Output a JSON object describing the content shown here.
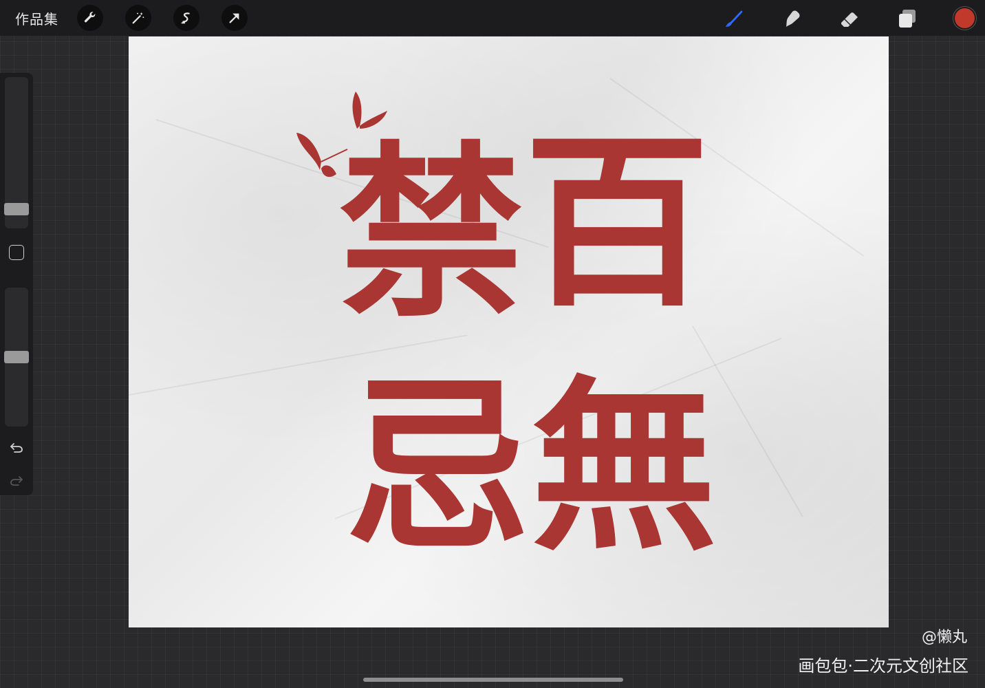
{
  "topbar": {
    "gallery_label": "作品集",
    "left_tools": [
      "wrench-icon",
      "magic-wand-icon",
      "selection-icon",
      "transform-arrow-icon"
    ],
    "right_tools": [
      "brush-icon",
      "smudge-icon",
      "eraser-icon",
      "layers-icon"
    ],
    "active_tool": "brush-icon",
    "active_color": "#c0392b",
    "brush_accent": "#2f6bff"
  },
  "sidebar": {
    "brush_size_level": 0.5,
    "opacity_level": 0.5
  },
  "canvas": {
    "characters": [
      "禁",
      "百",
      "忌",
      "無"
    ],
    "ink_color": "#a93632"
  },
  "watermark": {
    "author": "@懒丸",
    "site": "画包包·二次元文创社区"
  }
}
